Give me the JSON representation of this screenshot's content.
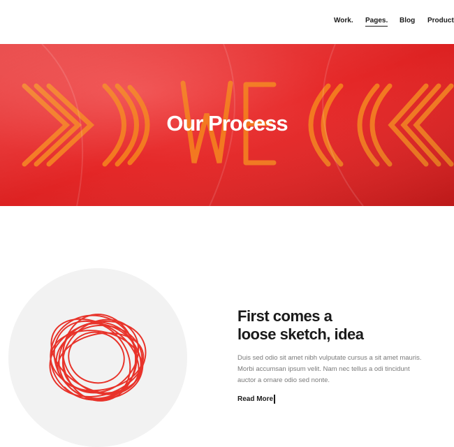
{
  "nav": {
    "items": [
      {
        "label": "Work."
      },
      {
        "label": "Pages."
      },
      {
        "label": "Blog"
      },
      {
        "label": "Products"
      }
    ],
    "active_index": 1
  },
  "hero": {
    "title": "Our Process",
    "background_color": "#e52828",
    "pattern_color": "#f47c1e"
  },
  "process": {
    "step_title_line1": "First comes a",
    "step_title_line2": "loose sketch, idea",
    "step_body": "Duis sed odio sit amet nibh vulputate cursus a sit amet mauris. Morbi accumsan ipsum velit. Nam nec tellus a odi tincidunt auctor a ornare odio sed nonte.",
    "read_more_label": "Read More",
    "scribble_color": "#e8332a"
  }
}
